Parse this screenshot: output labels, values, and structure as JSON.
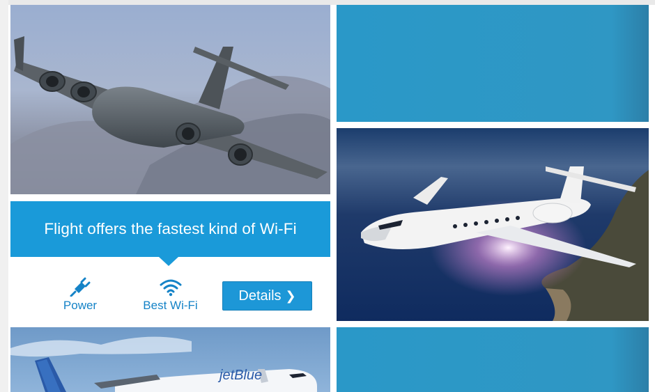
{
  "feed": {
    "tiles": [
      {
        "image": "c17-military-cargo-jet-photo"
      },
      {
        "image": "blue-gradient-placeholder"
      },
      {
        "image": "gulfstream-business-jet-photo"
      },
      {
        "image": "jetblue-airliner-photo",
        "livery_text": "jetBlue"
      },
      {
        "image": "blue-gradient-placeholder"
      }
    ],
    "card": {
      "headline": "Flight offers the fastest kind of Wi-Fi",
      "features": [
        {
          "icon": "power-plug-icon",
          "label": "Power"
        },
        {
          "icon": "wifi-icon",
          "label": "Best Wi-Fi"
        }
      ],
      "details_label": "Details",
      "details_chevron": "❯"
    }
  },
  "colors": {
    "accent": "#1a9ad9",
    "placeholder_blue": "#2f97c4",
    "feature_text": "#1583c7"
  }
}
